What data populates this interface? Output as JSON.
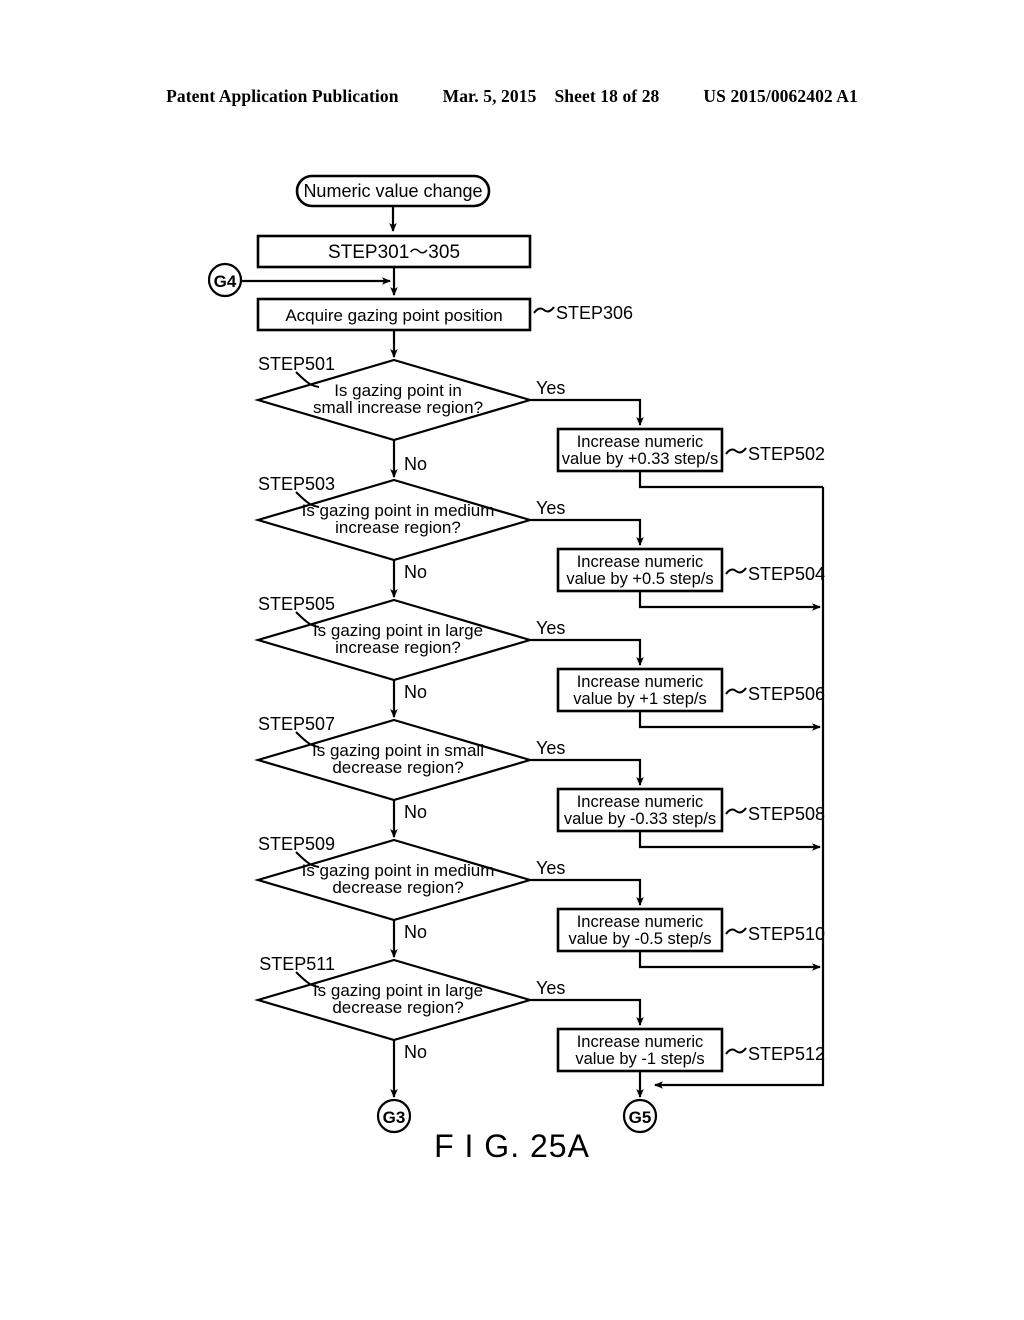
{
  "header": {
    "publication": "Patent Application Publication",
    "date": "Mar. 5, 2015",
    "sheet": "Sheet 18 of 28",
    "patent_number": "US 2015/0062402 A1"
  },
  "figure": {
    "caption": "F I G. 25A"
  },
  "flowchart": {
    "start_terminator": "Numeric value change",
    "process_steps": [
      {
        "id": "step301_305",
        "label": "STEP301～305",
        "tag": ""
      },
      {
        "id": "step306",
        "label": "Acquire gazing point position",
        "tag": "STEP306"
      }
    ],
    "entry_connector": "G4",
    "decisions": [
      {
        "tag": "STEP501",
        "line1": "Is gazing point in",
        "line2": "small increase region?",
        "yes": "Yes",
        "no": "No"
      },
      {
        "tag": "STEP503",
        "line1": "Is gazing point in medium",
        "line2": "increase region?",
        "yes": "Yes",
        "no": "No"
      },
      {
        "tag": "STEP505",
        "line1": "Is gazing point in large",
        "line2": "increase region?",
        "yes": "Yes",
        "no": "No"
      },
      {
        "tag": "STEP507",
        "line1": "Is gazing point in small",
        "line2": "decrease region?",
        "yes": "Yes",
        "no": "No"
      },
      {
        "tag": "STEP509",
        "line1": "Is gazing point in medium",
        "line2": "decrease region?",
        "yes": "Yes",
        "no": "No"
      },
      {
        "tag": "STEP511",
        "line1": "Is gazing point in large",
        "line2": "decrease region?",
        "yes": "Yes",
        "no": "No"
      }
    ],
    "actions": [
      {
        "tag": "STEP502",
        "line1": "Increase numeric",
        "line2": "value by +0.33 step/s"
      },
      {
        "tag": "STEP504",
        "line1": "Increase numeric",
        "line2": "value by +0.5 step/s"
      },
      {
        "tag": "STEP506",
        "line1": "Increase numeric",
        "line2": "value by +1 step/s"
      },
      {
        "tag": "STEP508",
        "line1": "Increase numeric",
        "line2": "value by -0.33 step/s"
      },
      {
        "tag": "STEP510",
        "line1": "Increase numeric",
        "line2": "value by -0.5 step/s"
      },
      {
        "tag": "STEP512",
        "line1": "Increase numeric",
        "line2": "value by -1 step/s"
      }
    ],
    "exit_connectors": [
      {
        "id": "g3",
        "label": "G3"
      },
      {
        "id": "g5",
        "label": "G5"
      }
    ]
  }
}
